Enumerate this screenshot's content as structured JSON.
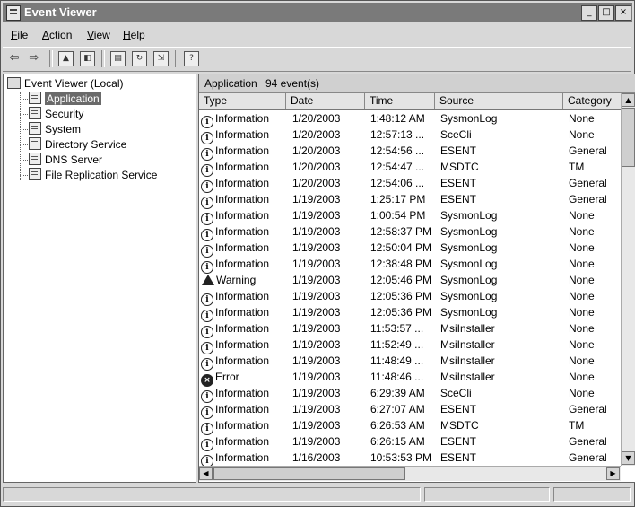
{
  "window": {
    "title": "Event Viewer",
    "minimize_glyph": "_",
    "maximize_glyph": "□",
    "close_glyph": "×"
  },
  "menu": [
    {
      "underline": "F",
      "rest": "ile"
    },
    {
      "underline": "A",
      "rest": "ction"
    },
    {
      "underline": "V",
      "rest": "iew"
    },
    {
      "underline": "H",
      "rest": "elp"
    }
  ],
  "toolbar": {
    "back_icon": "back-arrow-icon",
    "forward_icon": "forward-arrow-icon",
    "back_glyph": "⇦",
    "forward_glyph": "⇨"
  },
  "tree": {
    "root": "Event Viewer (Local)",
    "items": [
      "Application",
      "Security",
      "System",
      "Directory Service",
      "DNS Server",
      "File Replication Service"
    ],
    "selected": "Application"
  },
  "panel": {
    "log_name": "Application",
    "event_count": "94 event(s)"
  },
  "columns": [
    "Type",
    "Date",
    "Time",
    "Source",
    "Category"
  ],
  "events": [
    {
      "type": "Information",
      "date": "1/20/2003",
      "time": "1:48:12 AM",
      "source": "SysmonLog",
      "category": "None"
    },
    {
      "type": "Information",
      "date": "1/20/2003",
      "time": "12:57:13 ...",
      "source": "SceCli",
      "category": "None"
    },
    {
      "type": "Information",
      "date": "1/20/2003",
      "time": "12:54:56 ...",
      "source": "ESENT",
      "category": "General"
    },
    {
      "type": "Information",
      "date": "1/20/2003",
      "time": "12:54:47 ...",
      "source": "MSDTC",
      "category": "TM"
    },
    {
      "type": "Information",
      "date": "1/20/2003",
      "time": "12:54:06 ...",
      "source": "ESENT",
      "category": "General"
    },
    {
      "type": "Information",
      "date": "1/19/2003",
      "time": "1:25:17 PM",
      "source": "ESENT",
      "category": "General"
    },
    {
      "type": "Information",
      "date": "1/19/2003",
      "time": "1:00:54 PM",
      "source": "SysmonLog",
      "category": "None"
    },
    {
      "type": "Information",
      "date": "1/19/2003",
      "time": "12:58:37 PM",
      "source": "SysmonLog",
      "category": "None"
    },
    {
      "type": "Information",
      "date": "1/19/2003",
      "time": "12:50:04 PM",
      "source": "SysmonLog",
      "category": "None"
    },
    {
      "type": "Information",
      "date": "1/19/2003",
      "time": "12:38:48 PM",
      "source": "SysmonLog",
      "category": "None"
    },
    {
      "type": "Warning",
      "date": "1/19/2003",
      "time": "12:05:46 PM",
      "source": "SysmonLog",
      "category": "None"
    },
    {
      "type": "Information",
      "date": "1/19/2003",
      "time": "12:05:36 PM",
      "source": "SysmonLog",
      "category": "None"
    },
    {
      "type": "Information",
      "date": "1/19/2003",
      "time": "12:05:36 PM",
      "source": "SysmonLog",
      "category": "None"
    },
    {
      "type": "Information",
      "date": "1/19/2003",
      "time": "11:53:57 ...",
      "source": "MsiInstaller",
      "category": "None"
    },
    {
      "type": "Information",
      "date": "1/19/2003",
      "time": "11:52:49 ...",
      "source": "MsiInstaller",
      "category": "None"
    },
    {
      "type": "Information",
      "date": "1/19/2003",
      "time": "11:48:49 ...",
      "source": "MsiInstaller",
      "category": "None"
    },
    {
      "type": "Error",
      "date": "1/19/2003",
      "time": "11:48:46 ...",
      "source": "MsiInstaller",
      "category": "None"
    },
    {
      "type": "Information",
      "date": "1/19/2003",
      "time": "6:29:39 AM",
      "source": "SceCli",
      "category": "None"
    },
    {
      "type": "Information",
      "date": "1/19/2003",
      "time": "6:27:07 AM",
      "source": "ESENT",
      "category": "General"
    },
    {
      "type": "Information",
      "date": "1/19/2003",
      "time": "6:26:53 AM",
      "source": "MSDTC",
      "category": "TM"
    },
    {
      "type": "Information",
      "date": "1/19/2003",
      "time": "6:26:15 AM",
      "source": "ESENT",
      "category": "General"
    },
    {
      "type": "Information",
      "date": "1/16/2003",
      "time": "10:53:53 PM",
      "source": "ESENT",
      "category": "General"
    }
  ]
}
